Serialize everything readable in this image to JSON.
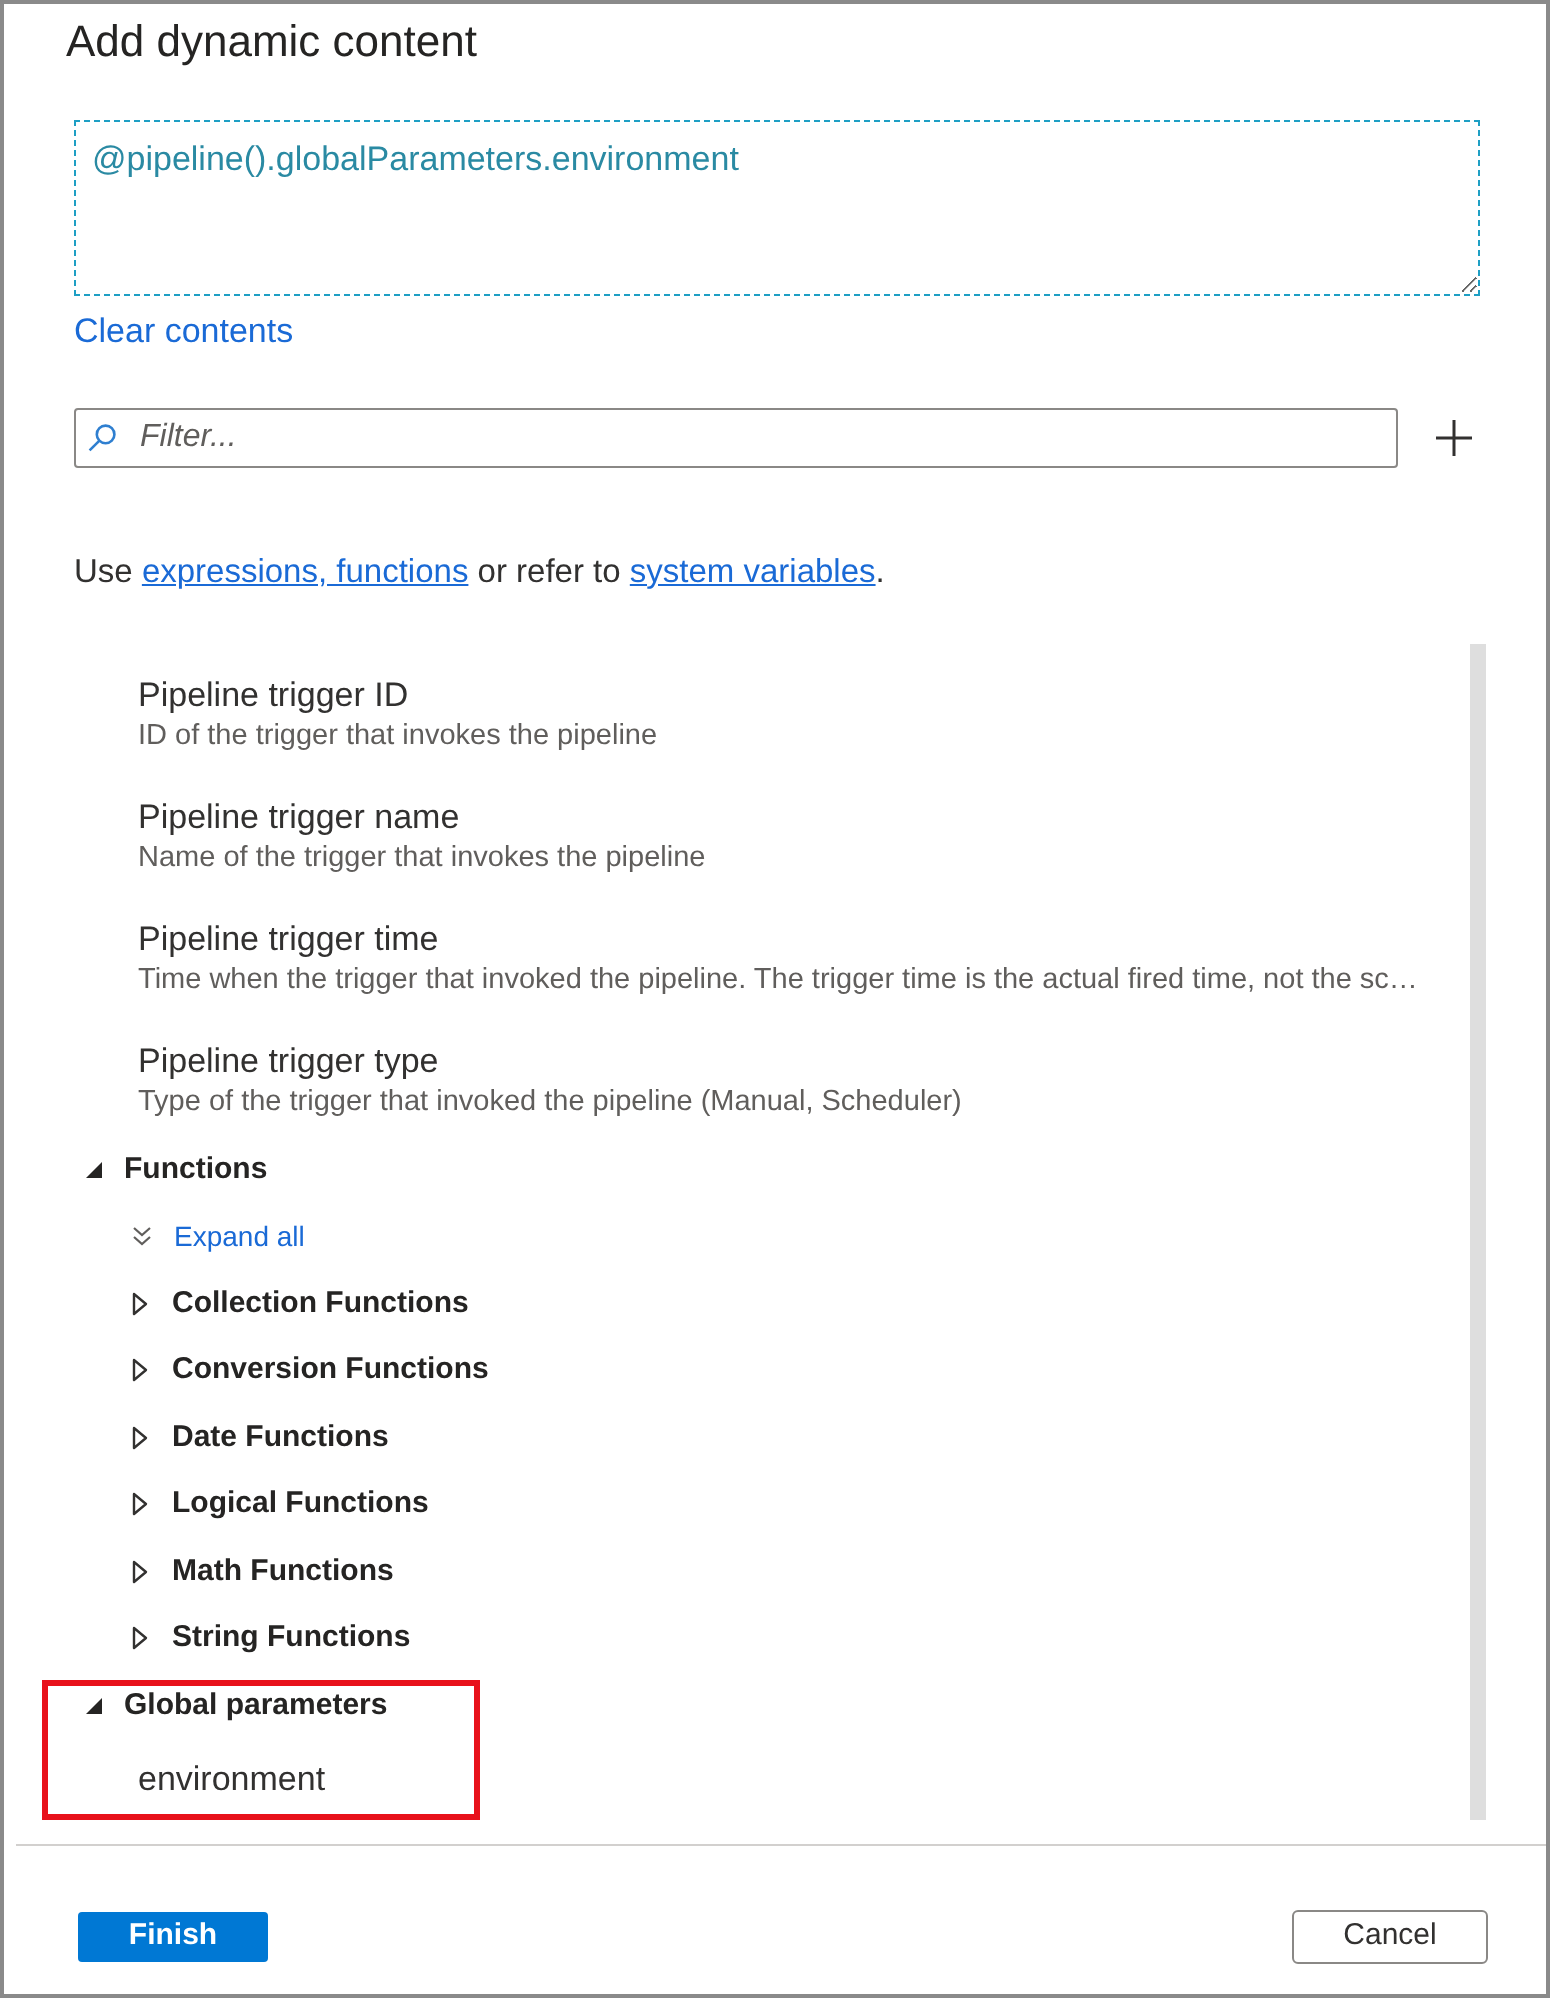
{
  "dialog": {
    "title": "Add dynamic content"
  },
  "expression": {
    "value": "@pipeline().globalParameters.environment"
  },
  "clear_link": {
    "label": "Clear contents"
  },
  "filter": {
    "placeholder": "Filter..."
  },
  "hint": [
    {
      "kind": "text",
      "text": "Use "
    },
    {
      "kind": "link",
      "text": "expressions, functions"
    },
    {
      "kind": "text",
      "text": " or refer to "
    },
    {
      "kind": "link",
      "text": "system variables"
    },
    {
      "kind": "text",
      "text": "."
    }
  ],
  "tree": [
    {
      "kind": "variable",
      "title": "Pipeline trigger ID",
      "description": "ID of the trigger that invokes the pipeline"
    },
    {
      "kind": "variable",
      "title": "Pipeline trigger name",
      "description": "Name of the trigger that invokes the pipeline"
    },
    {
      "kind": "variable",
      "title": "Pipeline trigger time",
      "description": "Time when the trigger that invoked the pipeline. The trigger time is the actual fired time, not the sc…"
    },
    {
      "kind": "variable",
      "title": "Pipeline trigger type",
      "description": "Type of the trigger that invoked the pipeline (Manual, Scheduler)"
    },
    {
      "kind": "group",
      "label": "Functions",
      "expanded": true,
      "highlighted": false,
      "children": [
        {
          "kind": "action",
          "label": "Expand all"
        },
        {
          "kind": "group",
          "label": "Collection Functions",
          "expanded": false,
          "highlighted": false
        },
        {
          "kind": "group",
          "label": "Conversion Functions",
          "expanded": false,
          "highlighted": false
        },
        {
          "kind": "group",
          "label": "Date Functions",
          "expanded": false,
          "highlighted": false
        },
        {
          "kind": "group",
          "label": "Logical Functions",
          "expanded": false,
          "highlighted": false
        },
        {
          "kind": "group",
          "label": "Math Functions",
          "expanded": false,
          "highlighted": false
        },
        {
          "kind": "group",
          "label": "String Functions",
          "expanded": false,
          "highlighted": false
        }
      ]
    },
    {
      "kind": "group",
      "label": "Global parameters",
      "expanded": true,
      "highlighted": true,
      "children": [
        {
          "kind": "parameter",
          "label": "environment"
        }
      ]
    }
  ],
  "buttons": [
    {
      "label": "Finish",
      "kind": "primary"
    },
    {
      "label": "Cancel",
      "kind": "secondary"
    }
  ]
}
